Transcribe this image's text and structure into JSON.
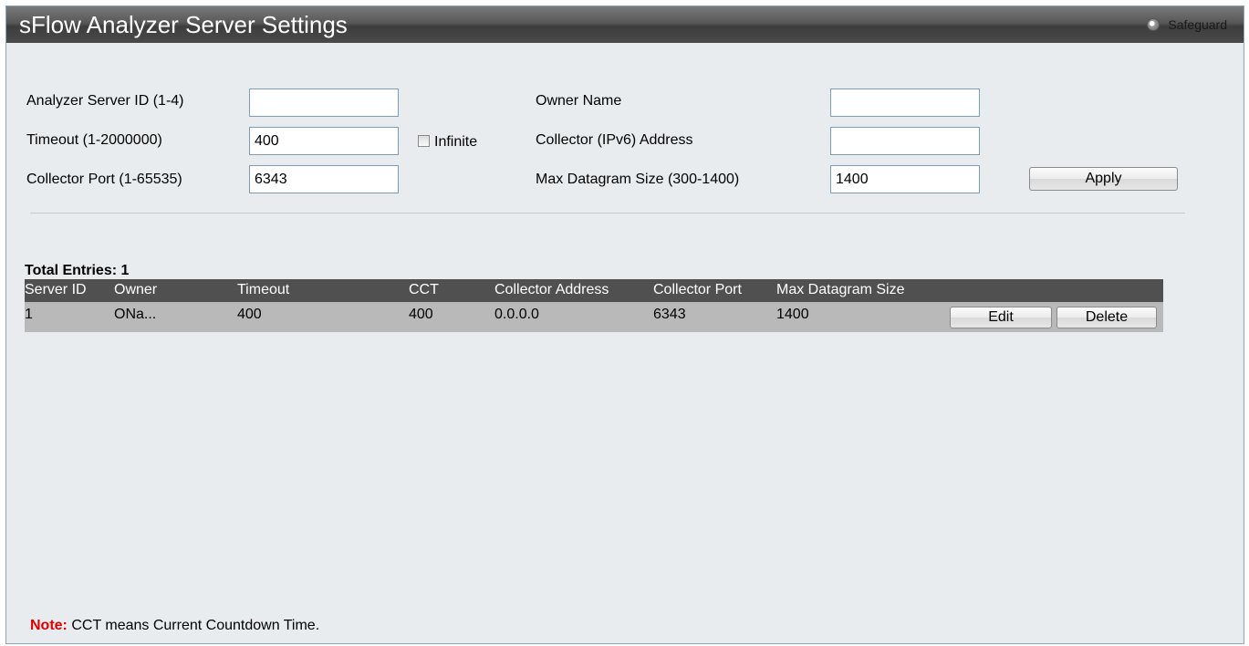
{
  "header": {
    "title": "sFlow Analyzer Server Settings",
    "safeguard_label": "Safeguard"
  },
  "form": {
    "server_id_label": "Analyzer Server ID (1-4)",
    "server_id_value": "",
    "timeout_label": "Timeout (1-2000000)",
    "timeout_value": "400",
    "infinite_label": "Infinite",
    "infinite_checked": false,
    "collector_port_label": "Collector Port (1-65535)",
    "collector_port_value": "6343",
    "owner_name_label": "Owner Name",
    "owner_name_value": "",
    "collector_address_label": "Collector (IPv6) Address",
    "collector_address_value": "",
    "max_datagram_label": "Max Datagram Size (300-1400)",
    "max_datagram_value": "1400",
    "apply_label": "Apply"
  },
  "table": {
    "total_entries": "Total Entries: 1",
    "columns": [
      "Server ID",
      "Owner",
      "Timeout",
      "CCT",
      "Collector Address",
      "Collector Port",
      "Max Datagram Size"
    ],
    "rows": [
      {
        "server_id": "1",
        "owner": "ONa...",
        "timeout": "400",
        "cct": "400",
        "collector_address": "0.0.0.0",
        "collector_port": "6343",
        "max_datagram_size": "1400",
        "edit_label": "Edit",
        "delete_label": "Delete"
      }
    ]
  },
  "note": {
    "prefix": "Note:",
    "text": " CCT means Current Countdown Time."
  }
}
